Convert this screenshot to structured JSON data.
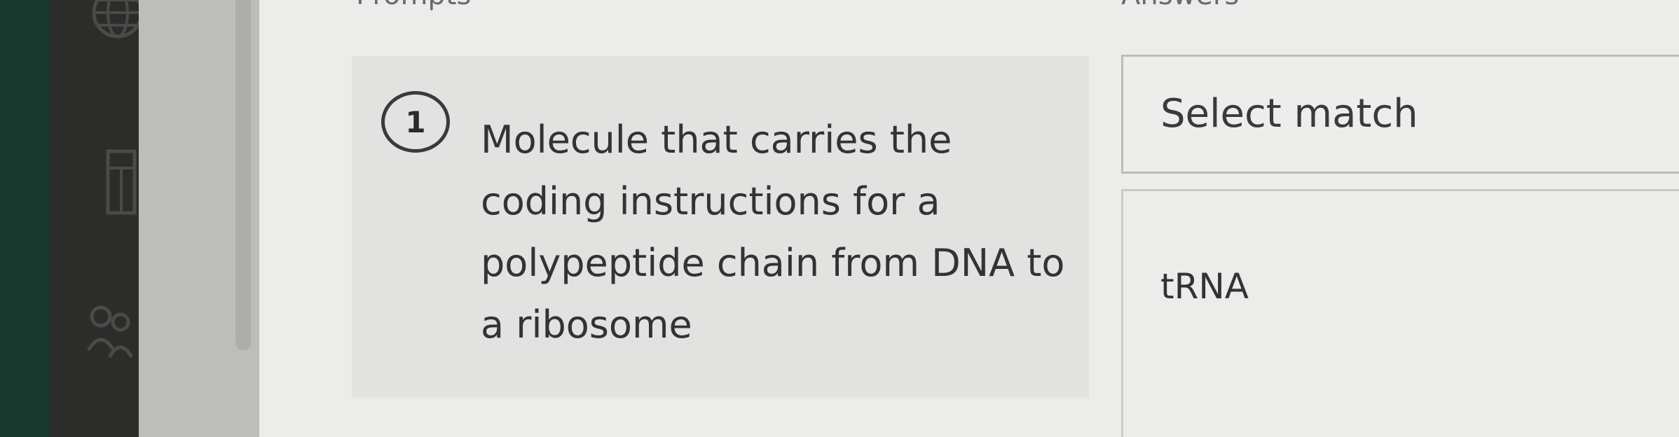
{
  "icons": {
    "sidebar": [
      "globe-icon",
      "grid-icon",
      "people-icon"
    ]
  },
  "columns": {
    "prompts_header": "Prompts",
    "answers_header": "Answers"
  },
  "prompt": {
    "number": "1",
    "text": "Molecule that carries the coding instructions for a polypeptide chain from DNA to a ribosome"
  },
  "answer": {
    "select_placeholder": "Select match",
    "option_label": "tRNA"
  },
  "colors": {
    "sidebar_bg": "#2c2d2b",
    "edge_bg": "#17382c",
    "content_bg": "#ececea",
    "text": "#333333"
  }
}
